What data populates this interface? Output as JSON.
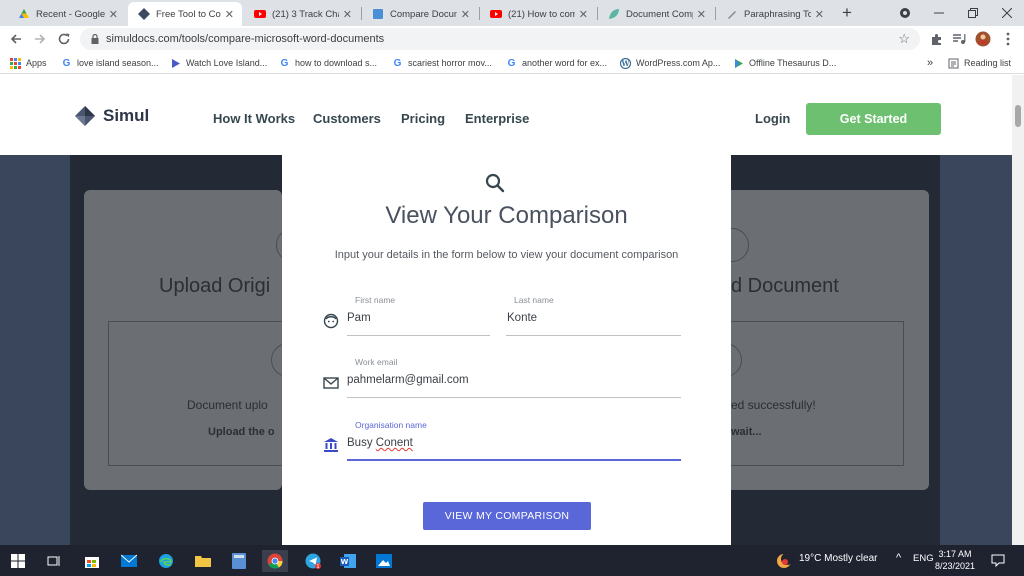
{
  "browser": {
    "tabs": [
      {
        "title": "Recent - Google D",
        "color": "#4285f4"
      },
      {
        "title": "Free Tool to Com",
        "color": "#3d4a63",
        "active": true
      },
      {
        "title": "(21) 3 Track Chan",
        "color": "#ff0000"
      },
      {
        "title": "Compare Docum",
        "color": "#4a90d9"
      },
      {
        "title": "(21) How to comp",
        "color": "#ff0000"
      },
      {
        "title": "Document Comp",
        "color": "#5bb5a2"
      },
      {
        "title": "Paraphrasing Too",
        "color": "#888888"
      }
    ],
    "new_tab": "+",
    "url": "simuldocs.com/tools/compare-microsoft-word-documents",
    "bookmarks": [
      {
        "label": "Apps"
      },
      {
        "label": "love island season..."
      },
      {
        "label": "Watch Love Island..."
      },
      {
        "label": "how to download s..."
      },
      {
        "label": "scariest horror mov..."
      },
      {
        "label": "another word for ex..."
      },
      {
        "label": "WordPress.com Ap..."
      },
      {
        "label": "Offline Thesaurus D..."
      }
    ],
    "more_bookmarks": "»",
    "reading_list": "Reading list"
  },
  "site": {
    "brand": "Simul",
    "nav": [
      "How It Works",
      "Customers",
      "Pricing",
      "Enterprise"
    ],
    "login": "Login",
    "get_started": "Get Started",
    "accent": "#6cc070"
  },
  "background": {
    "upload_original_partial": "Upload Origi",
    "revised_partial": "d Document",
    "uploaded_partial": "Document uplo",
    "uploaded_success_partial": "ed successfully!",
    "upload_instruction_partial": "Upload the o",
    "wait_partial": "wait..."
  },
  "modal": {
    "heading": "View Your Comparison",
    "subtitle": "Input your details in the form below to view your document comparison",
    "first_name_label": "First name",
    "first_name_value": "Pam",
    "last_name_label": "Last name",
    "last_name_value": "Konte",
    "email_label": "Work email",
    "email_value": "pahmelarm@gmail.com",
    "org_label": "Organisation name",
    "org_value_1": "Busy ",
    "org_value_2": "Conent",
    "submit": "VIEW MY COMPARISON",
    "accent": "#5a67d8"
  },
  "taskbar": {
    "weather": "19°C  Mostly clear",
    "lang": "ENG",
    "time": "3:17 AM",
    "date": "8/23/2021",
    "badge": "1"
  }
}
